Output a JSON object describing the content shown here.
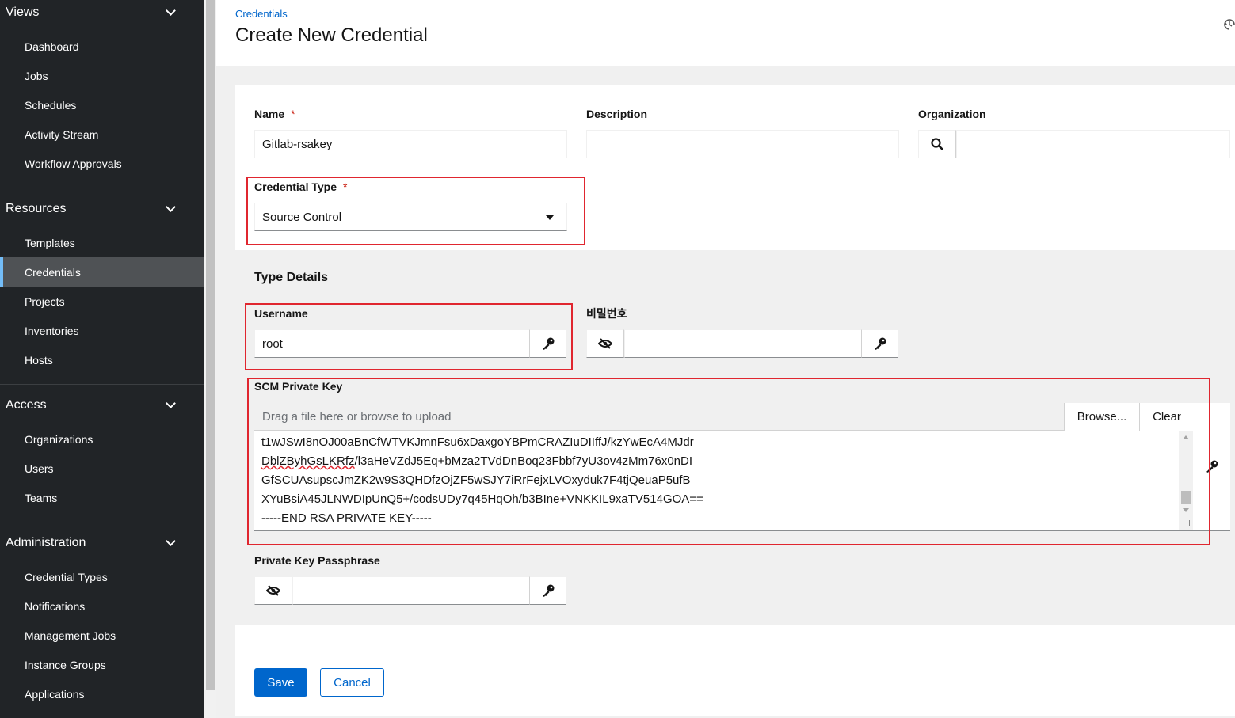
{
  "sidebar": {
    "groups": [
      {
        "title": "Views",
        "items": [
          "Dashboard",
          "Jobs",
          "Schedules",
          "Activity Stream",
          "Workflow Approvals"
        ]
      },
      {
        "title": "Resources",
        "items": [
          "Templates",
          "Credentials",
          "Projects",
          "Inventories",
          "Hosts"
        ]
      },
      {
        "title": "Access",
        "items": [
          "Organizations",
          "Users",
          "Teams"
        ]
      },
      {
        "title": "Administration",
        "items": [
          "Credential Types",
          "Notifications",
          "Management Jobs",
          "Instance Groups",
          "Applications"
        ]
      }
    ],
    "active_item": "Credentials",
    "accent_color": "#73bcf7"
  },
  "header": {
    "breadcrumb": "Credentials",
    "title": "Create New Credential"
  },
  "form": {
    "name_label": "Name",
    "name_value": "Gitlab-rsakey",
    "required_mark": "*",
    "description_label": "Description",
    "description_value": "",
    "organization_label": "Organization",
    "organization_value": "",
    "credential_type_label": "Credential Type",
    "credential_type_value": "Source Control",
    "type_details_title": "Type Details",
    "username_label": "Username",
    "username_value": "root",
    "password_label": "비밀번호",
    "password_value": "",
    "scm_key_label": "SCM Private Key",
    "file_placeholder": "Drag a file here or browse to upload",
    "browse_label": "Browse...",
    "clear_label": "Clear",
    "key_lines": [
      "t1wJSwI8nOJ00aBnCfWTVKJmnFsu6xDaxgoYBPmCRAZIuDIIffJ/kzYwEcA4MJdr",
      "DblZByhGsLKRfz/l3aHeVZdJ5Eq+bMza2TVdDnBoq23Fbbf7yU3ov4zMm76x0nDI",
      "GfSCUAsupscJmZK2w9S3QHDfzOjZF5wSJY7iRrFejxLVOxyduk7F4tjQeuaP5ufB",
      "XYuBsiA45JLNWDIpUnQ5+/codsUDy7q45HqOh/b3BIne+VNKKIL9xaTV514GOA==",
      "-----END RSA PRIVATE KEY-----"
    ],
    "key_line2_start": "DblZByhGsLKRfz",
    "key_line2_rest": "/l3aHeVZdJ5Eq+bMza2TVdDnBoq23Fbbf7yU3ov4zMm76x0nDI",
    "passphrase_label": "Private Key Passphrase",
    "passphrase_value": ""
  },
  "actions": {
    "save_label": "Save",
    "cancel_label": "Cancel"
  },
  "icons": {
    "search": "search-icon",
    "key": "key-icon",
    "eye_slash": "eye-slash-icon",
    "history": "history-icon",
    "caret": "caret-down-icon",
    "chevron": "chevron-down-icon"
  },
  "colors": {
    "primary": "#0066cc",
    "sidebar_bg": "#212427",
    "highlight_box": "#e0262f",
    "required": "#c9190b"
  }
}
